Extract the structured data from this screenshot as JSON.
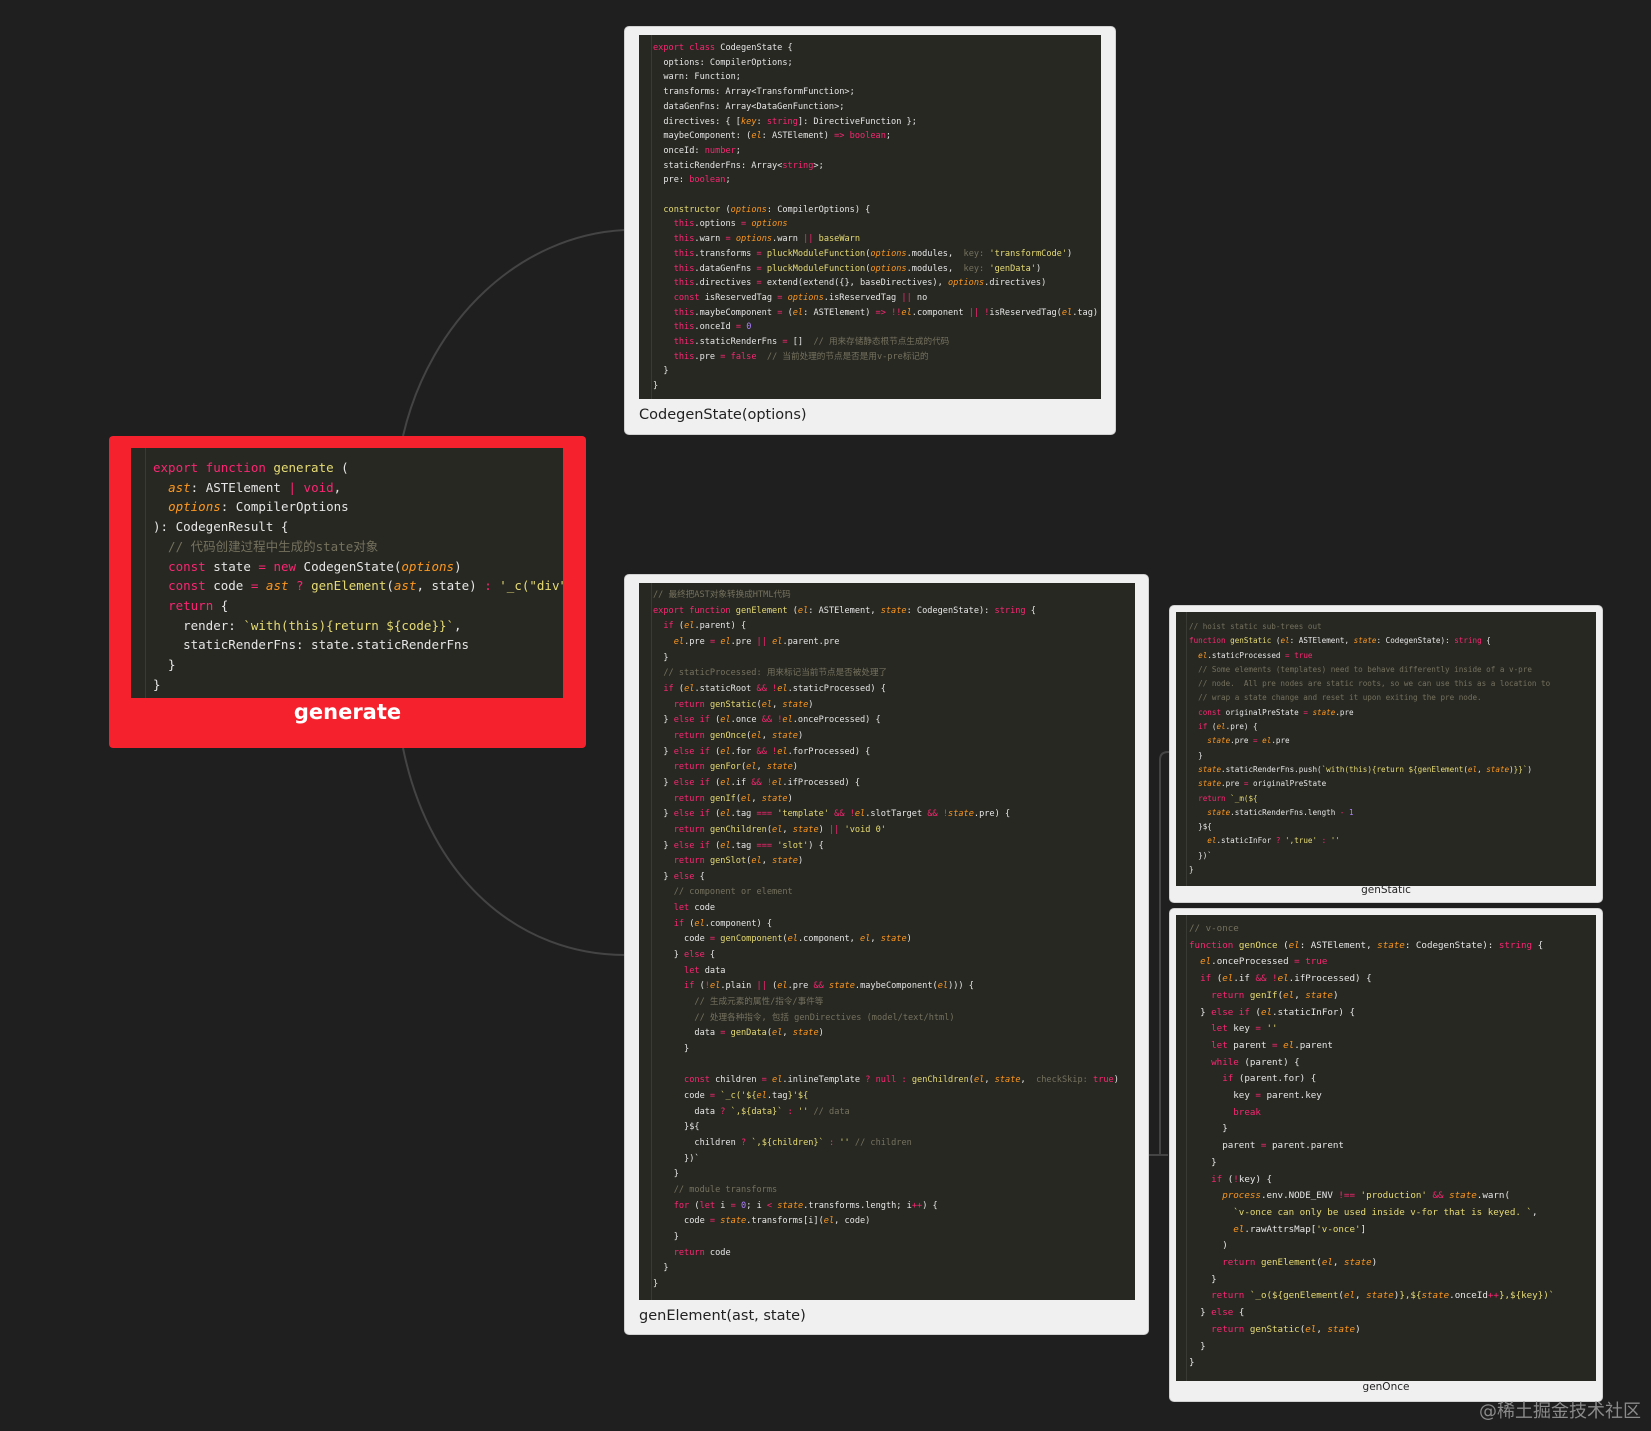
{
  "root": {
    "title": "generate",
    "lines": [
      "export function generate (",
      "  ast: ASTElement | void,",
      "  options: CompilerOptions",
      "): CodegenResult {",
      "  // 代码创建过程中生成的state对象",
      "  const state = new CodegenState(options)",
      "  const code = ast ? genElement(ast, state) : '_c(\"div\")'",
      "  return {",
      "    render: `with(this){return ${code}}`,",
      "    staticRenderFns: state.staticRenderFns",
      "  }",
      "}"
    ]
  },
  "nodes": [
    {
      "id": "codegen-state",
      "title": "CodegenState(options)",
      "lines": [
        "export class CodegenState {",
        "  options: CompilerOptions;",
        "  warn: Function;",
        "  transforms: Array<TransformFunction>;",
        "  dataGenFns: Array<DataGenFunction>;",
        "  directives: { [key: string]: DirectiveFunction };",
        "  maybeComponent: (el: ASTElement) => boolean;",
        "  onceId: number;",
        "  staticRenderFns: Array<string>;",
        "  pre: boolean;",
        "",
        "  constructor (options: CompilerOptions) {",
        "    this.options = options",
        "    this.warn = options.warn || baseWarn",
        "    this.transforms = pluckModuleFunction(options.modules, key: 'transformCode')",
        "    this.dataGenFns = pluckModuleFunction(options.modules, key: 'genData')",
        "    this.directives = extend(extend({}, baseDirectives), options.directives)",
        "    const isReservedTag = options.isReservedTag || no",
        "    this.maybeComponent = (el: ASTElement) => !!el.component || !isReservedTag(el.tag)",
        "    this.onceId = 0",
        "    this.staticRenderFns = []  // 用来存储静态根节点生成的代码",
        "    this.pre = false  // 当前处理的节点是否是用v-pre标记的",
        "  }",
        "}"
      ]
    },
    {
      "id": "gen-element",
      "title": "genElement(ast, state)",
      "lines": [
        "// 最终把AST对象转换成HTML代码",
        "export function genElement (el: ASTElement, state: CodegenState): string {",
        "  if (el.parent) {",
        "    el.pre = el.pre || el.parent.pre",
        "  }",
        "  // staticProcessed: 用来标记当前节点是否被处理了",
        "  if (el.staticRoot && !el.staticProcessed) {",
        "    return genStatic(el, state)",
        "  } else if (el.once && !el.onceProcessed) {",
        "    return genOnce(el, state)",
        "  } else if (el.for && !el.forProcessed) {",
        "    return genFor(el, state)",
        "  } else if (el.if && !el.ifProcessed) {",
        "    return genIf(el, state)",
        "  } else if (el.tag === 'template' && !el.slotTarget && !state.pre) {",
        "    return genChildren(el, state) || 'void 0'",
        "  } else if (el.tag === 'slot') {",
        "    return genSlot(el, state)",
        "  } else {",
        "    // component or element",
        "    let code",
        "    if (el.component) {",
        "      code = genComponent(el.component, el, state)",
        "    } else {",
        "      let data",
        "      if (!el.plain || (el.pre && state.maybeComponent(el))) {",
        "        // 生成元素的属性/指令/事件等",
        "        // 处理各种指令, 包括 genDirectives (model/text/html)",
        "        data = genData(el, state)",
        "      }",
        "",
        "      const children = el.inlineTemplate ? null : genChildren(el, state, checkSkip: true)",
        "      code = `_c('${el.tag}'${",
        "        data ? `,${data}` : '' // data",
        "      }${",
        "        children ? `,${children}` : '' // children",
        "      })`",
        "    }",
        "    // module transforms",
        "    for (let i = 0; i < state.transforms.length; i++) {",
        "      code = state.transforms[i](el, code)",
        "    }",
        "    return code",
        "  }",
        "}"
      ]
    },
    {
      "id": "gen-static",
      "title": "genStatic",
      "lines": [
        "// hoist static sub-trees out",
        "function genStatic (el: ASTElement, state: CodegenState): string {",
        "  el.staticProcessed = true",
        "  // Some elements (templates) need to behave differently inside of a v-pre",
        "  // node.  All pre nodes are static roots, so we can use this as a location to",
        "  // wrap a state change and reset it upon exiting the pre node.",
        "  const originalPreState = state.pre",
        "  if (el.pre) {",
        "    state.pre = el.pre",
        "  }",
        "  state.staticRenderFns.push(`with(this){return ${genElement(el, state)}}`)",
        "  state.pre = originalPreState",
        "  return `_m(${",
        "    state.staticRenderFns.length - 1",
        "  }${",
        "    el.staticInFor ? ',true' : ''",
        "  })`",
        "}"
      ]
    },
    {
      "id": "gen-once",
      "title": "genOnce",
      "lines": [
        "// v-once",
        "function genOnce (el: ASTElement, state: CodegenState): string {",
        "  el.onceProcessed = true",
        "  if (el.if && !el.ifProcessed) {",
        "    return genIf(el, state)",
        "  } else if (el.staticInFor) {",
        "    let key = ''",
        "    let parent = el.parent",
        "    while (parent) {",
        "      if (parent.for) {",
        "        key = parent.key",
        "        break",
        "      }",
        "      parent = parent.parent",
        "    }",
        "    if (!key) {",
        "      process.env.NODE_ENV !== 'production' && state.warn(",
        "        `v-once can only be used inside v-for that is keyed. `,",
        "        el.rawAttrsMap['v-once']",
        "      )",
        "      return genElement(el, state)",
        "    }",
        "    return `_o(${genElement(el, state)},${state.onceId++},${key})`",
        "  } else {",
        "    return genStatic(el, state)",
        "  }",
        "}"
      ]
    }
  ],
  "watermark": "@稀土掘金技术社区"
}
